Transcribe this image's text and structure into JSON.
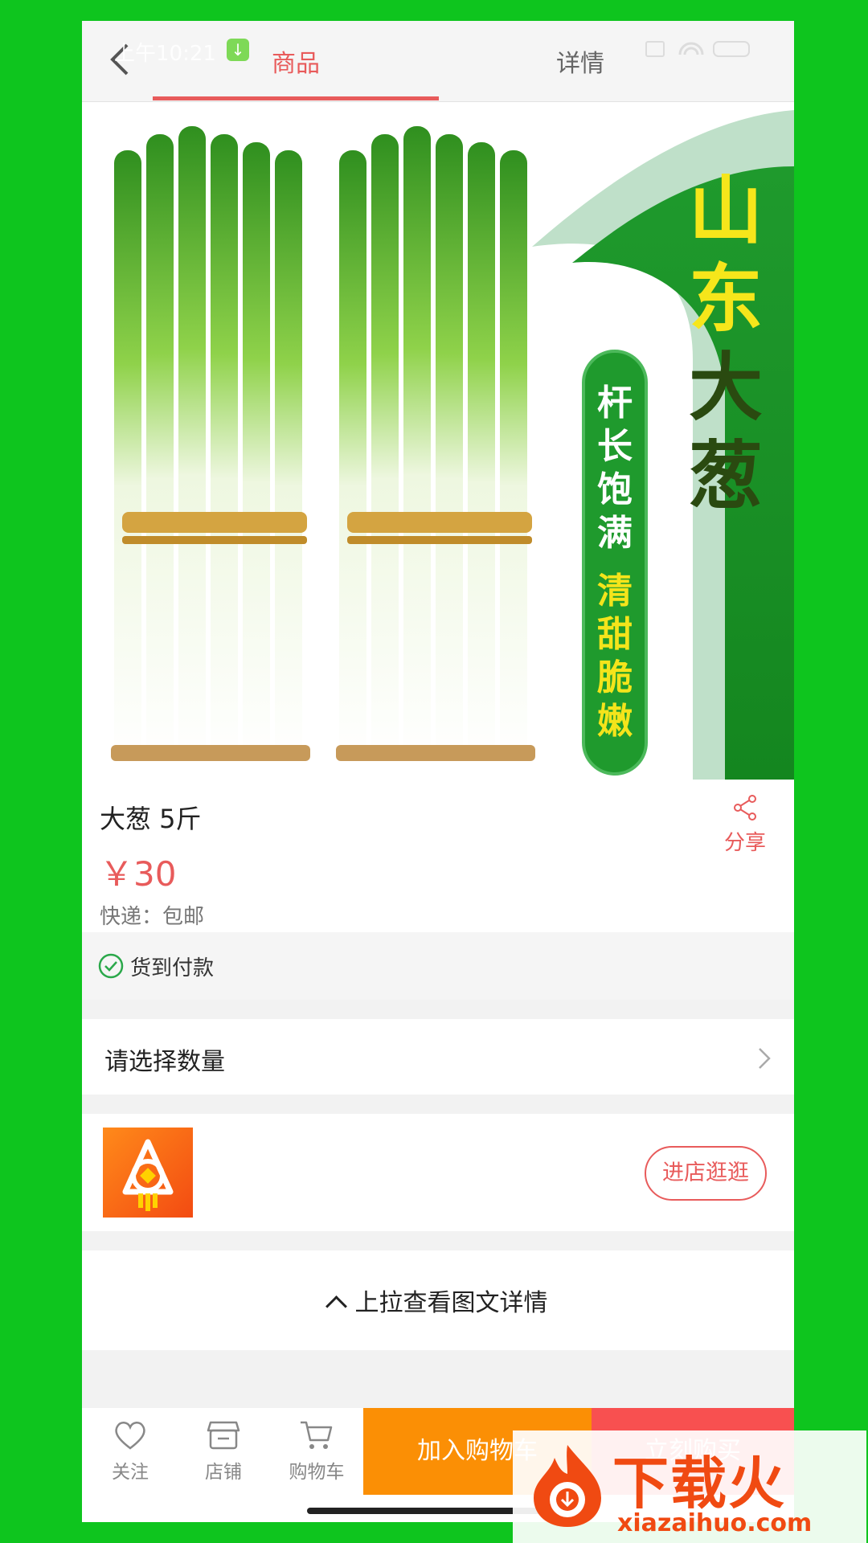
{
  "status_bar": {
    "time": "上午10:21",
    "download_glyph": "↓"
  },
  "tabs": [
    {
      "label": "商品",
      "active": true
    },
    {
      "label": "详情",
      "active": false
    }
  ],
  "colors": {
    "accent": "#e85b5b",
    "cart_button": "#fb8f05",
    "buy_button": "#f85050",
    "background": "#0ec51e"
  },
  "hero": {
    "title_chars": [
      "山",
      "东",
      "大",
      "葱"
    ],
    "pill_a_chars": [
      "杆",
      "长",
      "饱",
      "满"
    ],
    "pill_b_chars": [
      "清",
      "甜",
      "脆",
      "嫩"
    ]
  },
  "product": {
    "name": "大葱 5斤",
    "price": "￥30",
    "shipping": "快递：包邮",
    "share_label": "分享",
    "share_icon": "share-icon"
  },
  "service": {
    "cod_label": "货到付款",
    "cod_icon": "check-circle-icon"
  },
  "quantity": {
    "label": "请选择数量",
    "arrow_icon": "chevron-right-icon"
  },
  "shop": {
    "enter_label": "进店逛逛"
  },
  "pull_up": {
    "label": "上拉查看图文详情"
  },
  "bottom_bar": {
    "follow_label": "关注",
    "shop_label": "店铺",
    "cart_label": "购物车",
    "add_to_cart_label": "加入购物车",
    "buy_now_label": "立刻购买"
  },
  "watermark": {
    "brand": "下载火",
    "url": "xiazaihuo.com"
  }
}
